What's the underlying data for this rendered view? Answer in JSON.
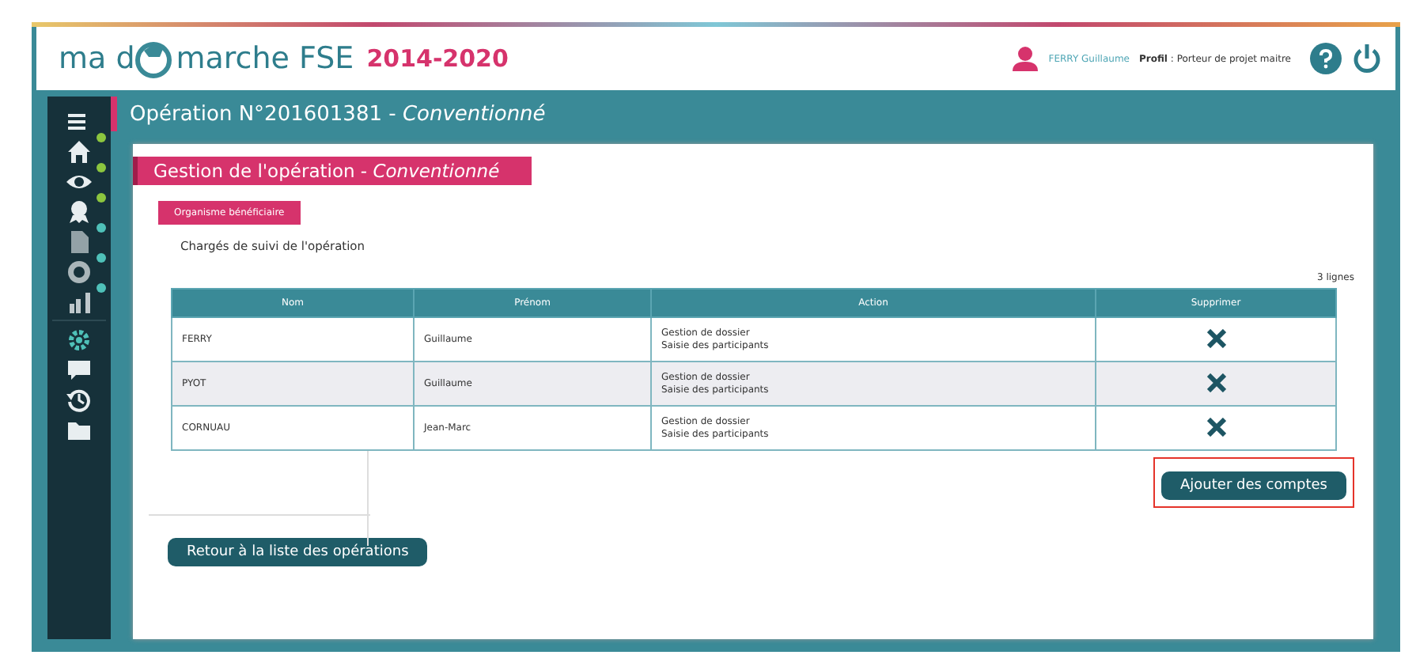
{
  "header": {
    "logo_before": "ma d",
    "logo_after": "marche FSE",
    "years": "2014-2020",
    "user": "FERRY Guillaume",
    "profile_label": "Profil",
    "profile_value": " : Porteur de projet maitre"
  },
  "sidebar": {
    "items": [
      {
        "kind": "menu",
        "selected": false
      },
      {
        "kind": "home",
        "selected": false,
        "color": "#8cc63f"
      },
      {
        "kind": "eye",
        "selected": false,
        "color": "#8cc63f"
      },
      {
        "kind": "award",
        "selected": false,
        "color": "#8cc63f"
      },
      {
        "kind": "document",
        "selected": false,
        "color": "#4fc1b9"
      },
      {
        "kind": "target",
        "selected": false,
        "color": "#4fc1b9"
      },
      {
        "kind": "chart",
        "selected": false,
        "color": "#4fc1b9"
      },
      {
        "kind": "gear",
        "selected": true
      },
      {
        "kind": "chat",
        "selected": false
      },
      {
        "kind": "history",
        "selected": false
      },
      {
        "kind": "folder",
        "selected": false
      }
    ]
  },
  "title_bar": {
    "title": "Opération N°201601381 - ",
    "status": "Conventionné"
  },
  "section": {
    "title": "Gestion de l'opération - ",
    "status": "Conventionné",
    "tab": "Organisme bénéficiaire",
    "subtitle": "Chargés de suivi de l'opération",
    "count": "3 lignes"
  },
  "table": {
    "columns": [
      "Nom",
      "Prénom",
      "Action",
      "Supprimer"
    ],
    "rows": [
      {
        "nom": "FERRY",
        "prenom": "Guillaume",
        "actions": [
          "Gestion de dossier",
          "Saisie des participants"
        ]
      },
      {
        "nom": "PYOT",
        "prenom": "Guillaume",
        "actions": [
          "Gestion de dossier",
          "Saisie des participants"
        ]
      },
      {
        "nom": "CORNUAU",
        "prenom": "Jean-Marc",
        "actions": [
          "Gestion de dossier",
          "Saisie des participants"
        ]
      }
    ]
  },
  "add_button": {
    "label": "Ajouter des comptes",
    "highlighted": true
  },
  "back_button": {
    "label": "Retour à la liste des opérations"
  }
}
